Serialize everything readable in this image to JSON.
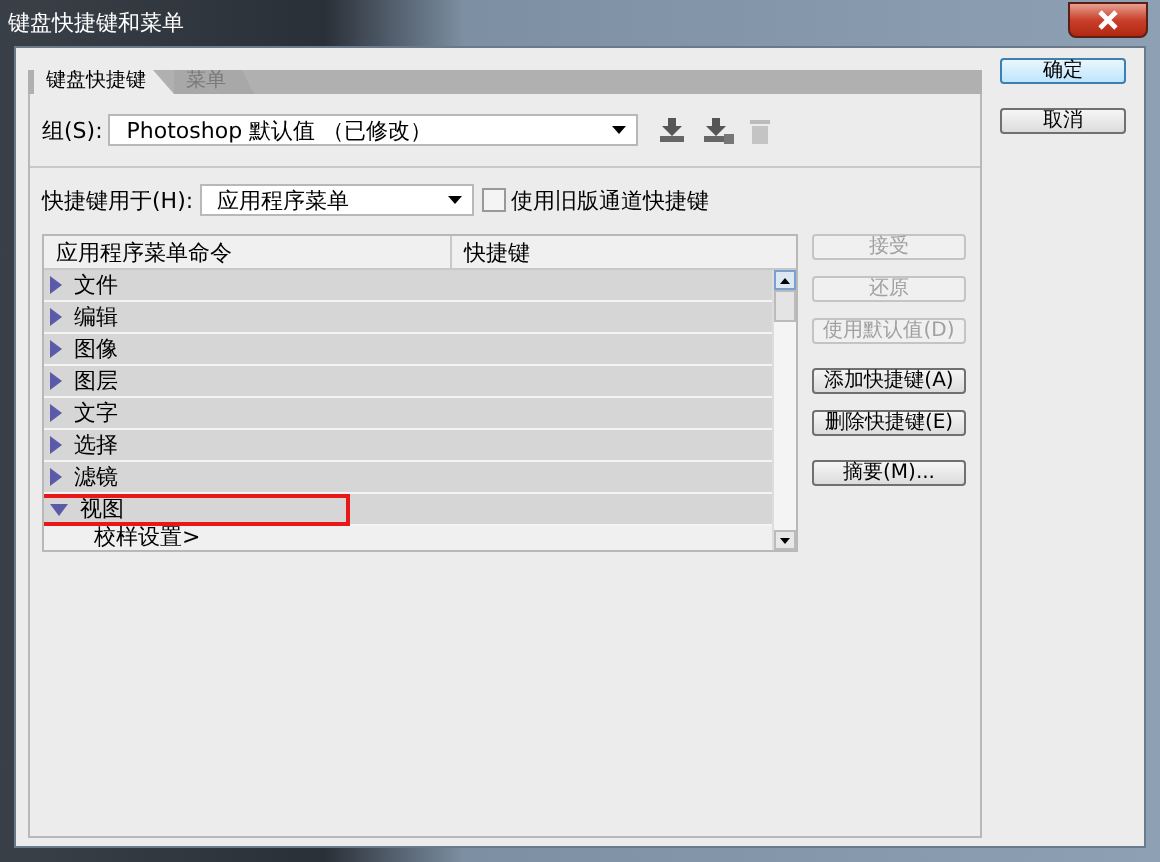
{
  "window": {
    "title": "键盘快捷键和菜单"
  },
  "tabs": [
    {
      "label": "键盘快捷键",
      "selected": true
    },
    {
      "label": "菜单",
      "selected": false
    }
  ],
  "dialog_buttons": [
    "确定",
    "取消"
  ],
  "set": {
    "label": "组(S):",
    "value": "Photoshop 默认值 （已修改）"
  },
  "shortcuts_for": {
    "label": "快捷键用于(H):",
    "value": "应用程序菜单"
  },
  "legacy_channel": {
    "label": "使用旧版通道快捷键",
    "checked": false
  },
  "table": {
    "columns": [
      "应用程序菜单命令",
      "快捷键"
    ],
    "rows": [
      {
        "label": "文件",
        "expanded": false,
        "highlighted": false
      },
      {
        "label": "编辑",
        "expanded": false,
        "highlighted": false
      },
      {
        "label": "图像",
        "expanded": false,
        "highlighted": false
      },
      {
        "label": "图层",
        "expanded": false,
        "highlighted": false
      },
      {
        "label": "文字",
        "expanded": false,
        "highlighted": false
      },
      {
        "label": "选择",
        "expanded": false,
        "highlighted": false
      },
      {
        "label": "滤镜",
        "expanded": false,
        "highlighted": false
      },
      {
        "label": "视图",
        "expanded": true,
        "highlighted": true,
        "children": [
          {
            "label": "校样设置>"
          }
        ]
      }
    ]
  },
  "side_buttons": [
    {
      "label": "接受",
      "disabled": true
    },
    {
      "label": "还原",
      "disabled": true
    },
    {
      "label": "使用默认值(D)",
      "disabled": true
    },
    {
      "label": "添加快捷键(A)",
      "disabled": false
    },
    {
      "label": "删除快捷键(E)",
      "disabled": false
    },
    {
      "label": "摘要(M)...",
      "disabled": false
    }
  ]
}
